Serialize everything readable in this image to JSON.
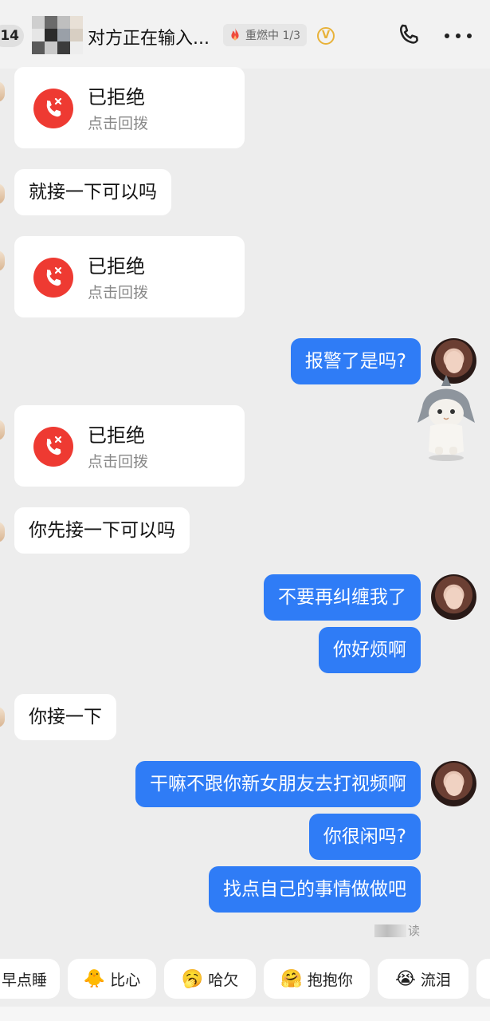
{
  "header": {
    "back_count": "14",
    "title": "对方正在输入...",
    "streak_label": "重燃中 1/3",
    "vip_mark": "V"
  },
  "messages": [
    {
      "type": "call",
      "side": "in",
      "status": "已拒绝",
      "action": "点击回拨"
    },
    {
      "type": "text",
      "side": "in",
      "text": "就接一下可以吗"
    },
    {
      "type": "call",
      "side": "in",
      "status": "已拒绝",
      "action": "点击回拨"
    },
    {
      "type": "text",
      "side": "out",
      "text": "报警了是吗?"
    },
    {
      "type": "sticker",
      "side": "out",
      "name": "shark-hood-cat-sticker"
    },
    {
      "type": "call",
      "side": "in",
      "status": "已拒绝",
      "action": "点击回拨"
    },
    {
      "type": "text",
      "side": "in",
      "text": "你先接一下可以吗"
    },
    {
      "type": "text",
      "side": "out",
      "text": "不要再纠缠我了"
    },
    {
      "type": "text",
      "side": "out",
      "text": "你好烦啊"
    },
    {
      "type": "text",
      "side": "in",
      "text": "你接一下"
    },
    {
      "type": "text",
      "side": "out",
      "text": "干嘛不跟你新女朋友去打视频啊"
    },
    {
      "type": "text",
      "side": "out",
      "text": "你很闲吗?"
    },
    {
      "type": "text",
      "side": "out",
      "text": "找点自己的事情做做吧"
    }
  ],
  "read_status": "读",
  "quick_replies": [
    {
      "emoji": "",
      "label": "早点睡"
    },
    {
      "emoji": "🐥",
      "label": "比心"
    },
    {
      "emoji": "🥱",
      "label": "哈欠"
    },
    {
      "emoji": "🤗",
      "label": "抱抱你"
    },
    {
      "emoji": "😭",
      "label": "流泪"
    }
  ],
  "colors": {
    "background": "#ededed",
    "outgoing_bubble": "#2f7cf6",
    "incoming_bubble": "#ffffff",
    "missed_call": "#ee3a32",
    "vip": "#e8b23a"
  }
}
